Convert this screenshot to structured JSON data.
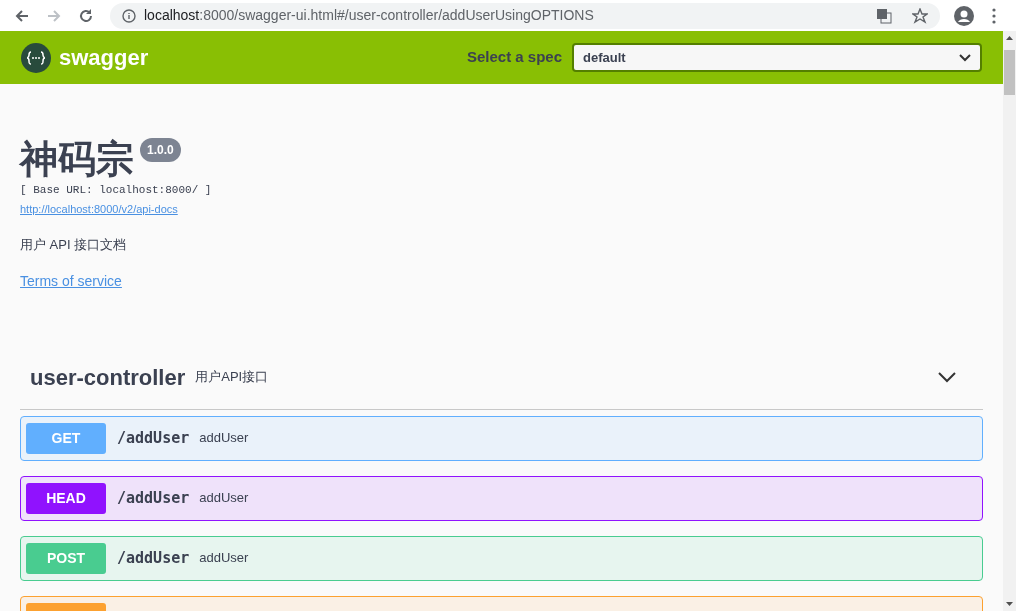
{
  "browser": {
    "url_host": "localhost",
    "url_rest": ":8000/swagger-ui.html#/user-controller/addUserUsingOPTIONS"
  },
  "topbar": {
    "brand": "swagger",
    "spec_label": "Select a spec",
    "spec_value": "default"
  },
  "info": {
    "title": "神码宗",
    "version": "1.0.0",
    "base_url": "[ Base URL: localhost:8000/ ]",
    "docs_link": "http://localhost:8000/v2/api-docs",
    "description": "用户 API 接口文档",
    "terms_link": "Terms of service"
  },
  "tag": {
    "name": "user-controller",
    "description": "用户API接口",
    "expanded": true
  },
  "operations": [
    {
      "method": "GET",
      "path": "/addUser",
      "summary": "addUser",
      "color": "#61affe"
    },
    {
      "method": "HEAD",
      "path": "/addUser",
      "summary": "addUser",
      "color": "#9012fe"
    },
    {
      "method": "POST",
      "path": "/addUser",
      "summary": "addUser",
      "color": "#49cc90"
    },
    {
      "color": "#fca130"
    }
  ]
}
